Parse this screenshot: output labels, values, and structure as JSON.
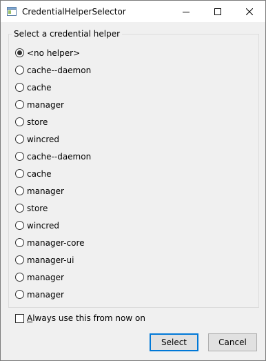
{
  "window": {
    "title": "CredentialHelperSelector",
    "controls": [
      "minimize-icon",
      "maximize-icon",
      "close-icon"
    ]
  },
  "group": {
    "title": "Select a credential helper",
    "selected_index": 0,
    "options": [
      {
        "label": "<no helper>"
      },
      {
        "label": "cache--daemon"
      },
      {
        "label": "cache"
      },
      {
        "label": "manager"
      },
      {
        "label": "store"
      },
      {
        "label": "wincred"
      },
      {
        "label": "cache--daemon"
      },
      {
        "label": "cache"
      },
      {
        "label": "manager"
      },
      {
        "label": "store"
      },
      {
        "label": "wincred"
      },
      {
        "label": "manager-core"
      },
      {
        "label": "manager-ui"
      },
      {
        "label": "manager"
      },
      {
        "label": "manager"
      }
    ]
  },
  "checkbox": {
    "label_accel": "A",
    "label_rest": "lways use this from now on",
    "checked": false
  },
  "buttons": {
    "select": "Select",
    "cancel": "Cancel"
  },
  "colors": {
    "focus_border": "#0078d7"
  }
}
